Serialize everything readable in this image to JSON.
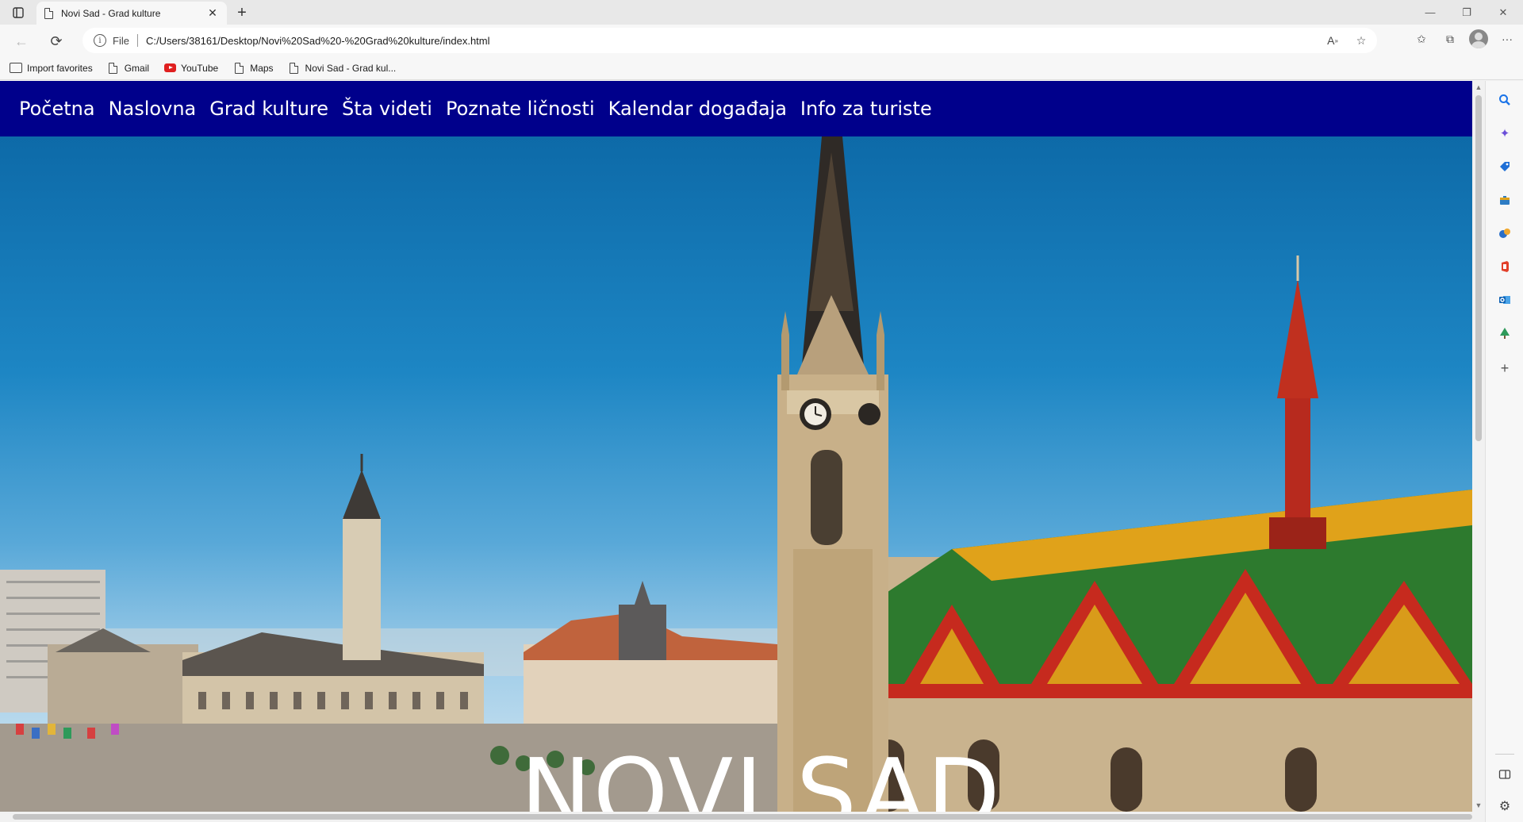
{
  "browser": {
    "tab_title": "Novi Sad - Grad kulture",
    "address_scheme": "File",
    "address_url": "C:/Users/38161/Desktop/Novi%20Sad%20-%20Grad%20kulture/index.html"
  },
  "favorites": [
    {
      "label": "Import favorites",
      "icon": "import-icon"
    },
    {
      "label": "Gmail",
      "icon": "page-icon"
    },
    {
      "label": "YouTube",
      "icon": "youtube-icon"
    },
    {
      "label": "Maps",
      "icon": "page-icon"
    },
    {
      "label": "Novi Sad - Grad kul...",
      "icon": "page-icon"
    }
  ],
  "site": {
    "nav": [
      "Početna",
      "Naslovna",
      "Grad kulture",
      "Šta videti",
      "Poznate ličnosti",
      "Kalendar događaja",
      "Info za turiste"
    ],
    "hero_title": "NOVI SAD",
    "nav_color": "#00008b"
  },
  "sidebar_icons": [
    "search-icon",
    "copilot-icon",
    "tag-icon",
    "toolbox-icon",
    "games-icon",
    "office-icon",
    "outlook-icon",
    "tree-icon",
    "add-icon"
  ],
  "bottom_icons": [
    "split-screen-icon",
    "settings-icon"
  ]
}
